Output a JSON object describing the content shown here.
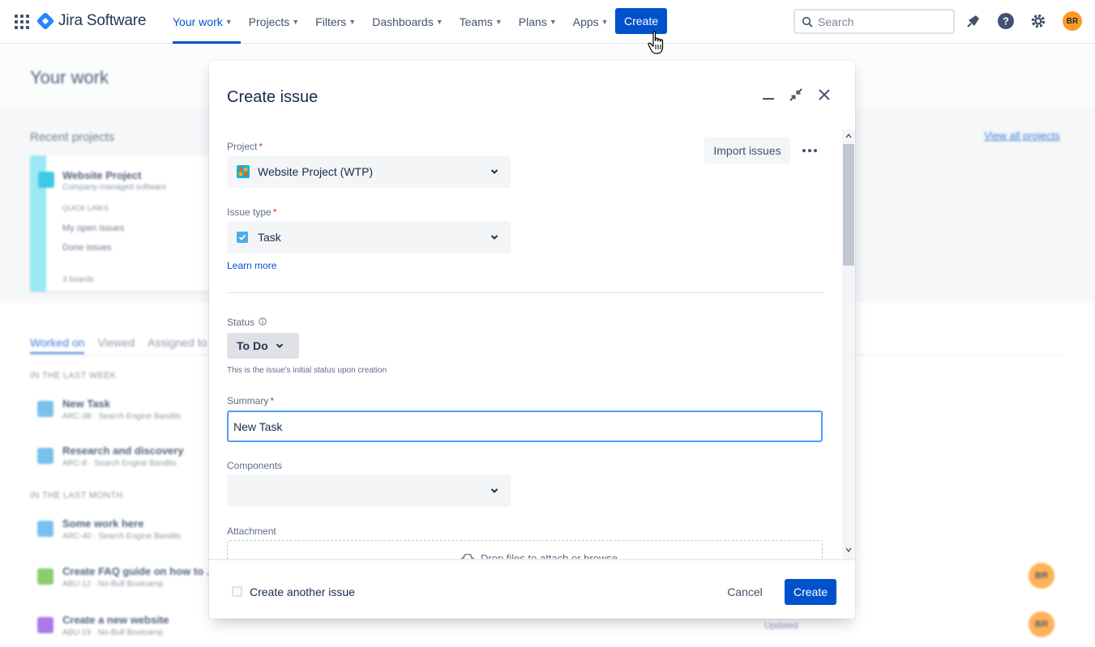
{
  "topnav": {
    "app_name": "Jira Software",
    "items": [
      {
        "label": "Your work",
        "active": true
      },
      {
        "label": "Projects"
      },
      {
        "label": "Filters"
      },
      {
        "label": "Dashboards"
      },
      {
        "label": "Teams"
      },
      {
        "label": "Plans"
      },
      {
        "label": "Apps"
      }
    ],
    "create_label": "Create",
    "search_placeholder": "Search",
    "icons": [
      "apps-grid-icon",
      "notification-icon",
      "help-icon",
      "settings-icon"
    ],
    "avatar_initials": "BR"
  },
  "background": {
    "page_title": "Your work",
    "recent_projects": "Recent projects",
    "view_all": "View all projects",
    "project_card": {
      "name": "Website Project",
      "type": "Company-managed software",
      "quick_links": "QUICK LINKS",
      "links": [
        "My open issues",
        "Done issues"
      ],
      "boards": "3 boards"
    },
    "tabs": [
      "Worked on",
      "Viewed",
      "Assigned to me"
    ],
    "sections": [
      "IN THE LAST WEEK",
      "IN THE LAST MONTH"
    ],
    "issues": [
      {
        "title": "New Task",
        "meta": "ARC-38  ·  Search Engine Bandits"
      },
      {
        "title": "Research and discovery",
        "meta": "ARC-8  ·  Search Engine Bandits"
      },
      {
        "title": "Some work here",
        "meta": "ARC-40  ·  Search Engine Bandits"
      },
      {
        "title": "Create FAQ guide on how to ...",
        "meta": "ABU-12  ·  No-Bull Bootcamp"
      },
      {
        "title": "Create a new website",
        "meta": "ABU-19  ·  No-Bull Bootcamp"
      }
    ],
    "updated": "Updated",
    "avatar_initials": "BR"
  },
  "modal": {
    "title": "Create issue",
    "header_icons": [
      "minimize-icon",
      "collapse-icon",
      "close-icon"
    ],
    "import_label": "Import issues",
    "project": {
      "label": "Project",
      "value": "Website Project (WTP)"
    },
    "issue_type": {
      "label": "Issue type",
      "value": "Task"
    },
    "learn_more": "Learn more",
    "status": {
      "label": "Status",
      "value": "To Do",
      "help": "This is the issue's initial status upon creation"
    },
    "summary": {
      "label": "Summary",
      "value": "New Task"
    },
    "components": {
      "label": "Components",
      "value": ""
    },
    "attachment": {
      "label": "Attachment",
      "drop_text": "Drop files to attach or browse"
    },
    "footer": {
      "create_another": "Create another issue",
      "cancel": "Cancel",
      "create": "Create"
    }
  },
  "colors": {
    "primary": "#0052cc",
    "required": "#de350b",
    "focus": "#4c9aff",
    "avatar": "#ff991f"
  }
}
